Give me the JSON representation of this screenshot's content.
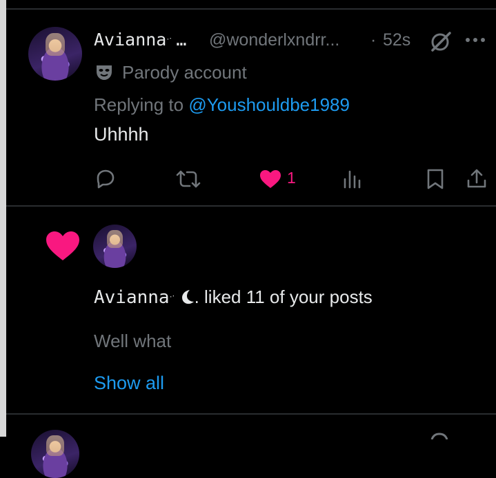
{
  "tweet": {
    "display_name": "Avianna",
    "display_name_suffix": "…",
    "handle": "@wonderlxndrr...",
    "separator": "·",
    "time": "52s",
    "badge_label": "Parody account",
    "replying_prefix": "Replying to",
    "replying_handle": "@Youshouldbe1989",
    "text": "Uhhhh",
    "like_count": "1",
    "colors": {
      "like": "#f91880",
      "link": "#1d9bf0",
      "muted": "#71767b"
    },
    "icons": [
      "reply-icon",
      "retweet-icon",
      "heart-icon",
      "views-icon",
      "bookmark-icon",
      "share-icon",
      "grok-icon",
      "more-icon",
      "parody-mask-icon"
    ]
  },
  "notification": {
    "actor_name": "Avianna",
    "action_text": ". liked 11 of your posts",
    "preview_text": "Well what",
    "show_all_label": "Show all",
    "icons": [
      "heart-icon",
      "moon-icon"
    ]
  }
}
